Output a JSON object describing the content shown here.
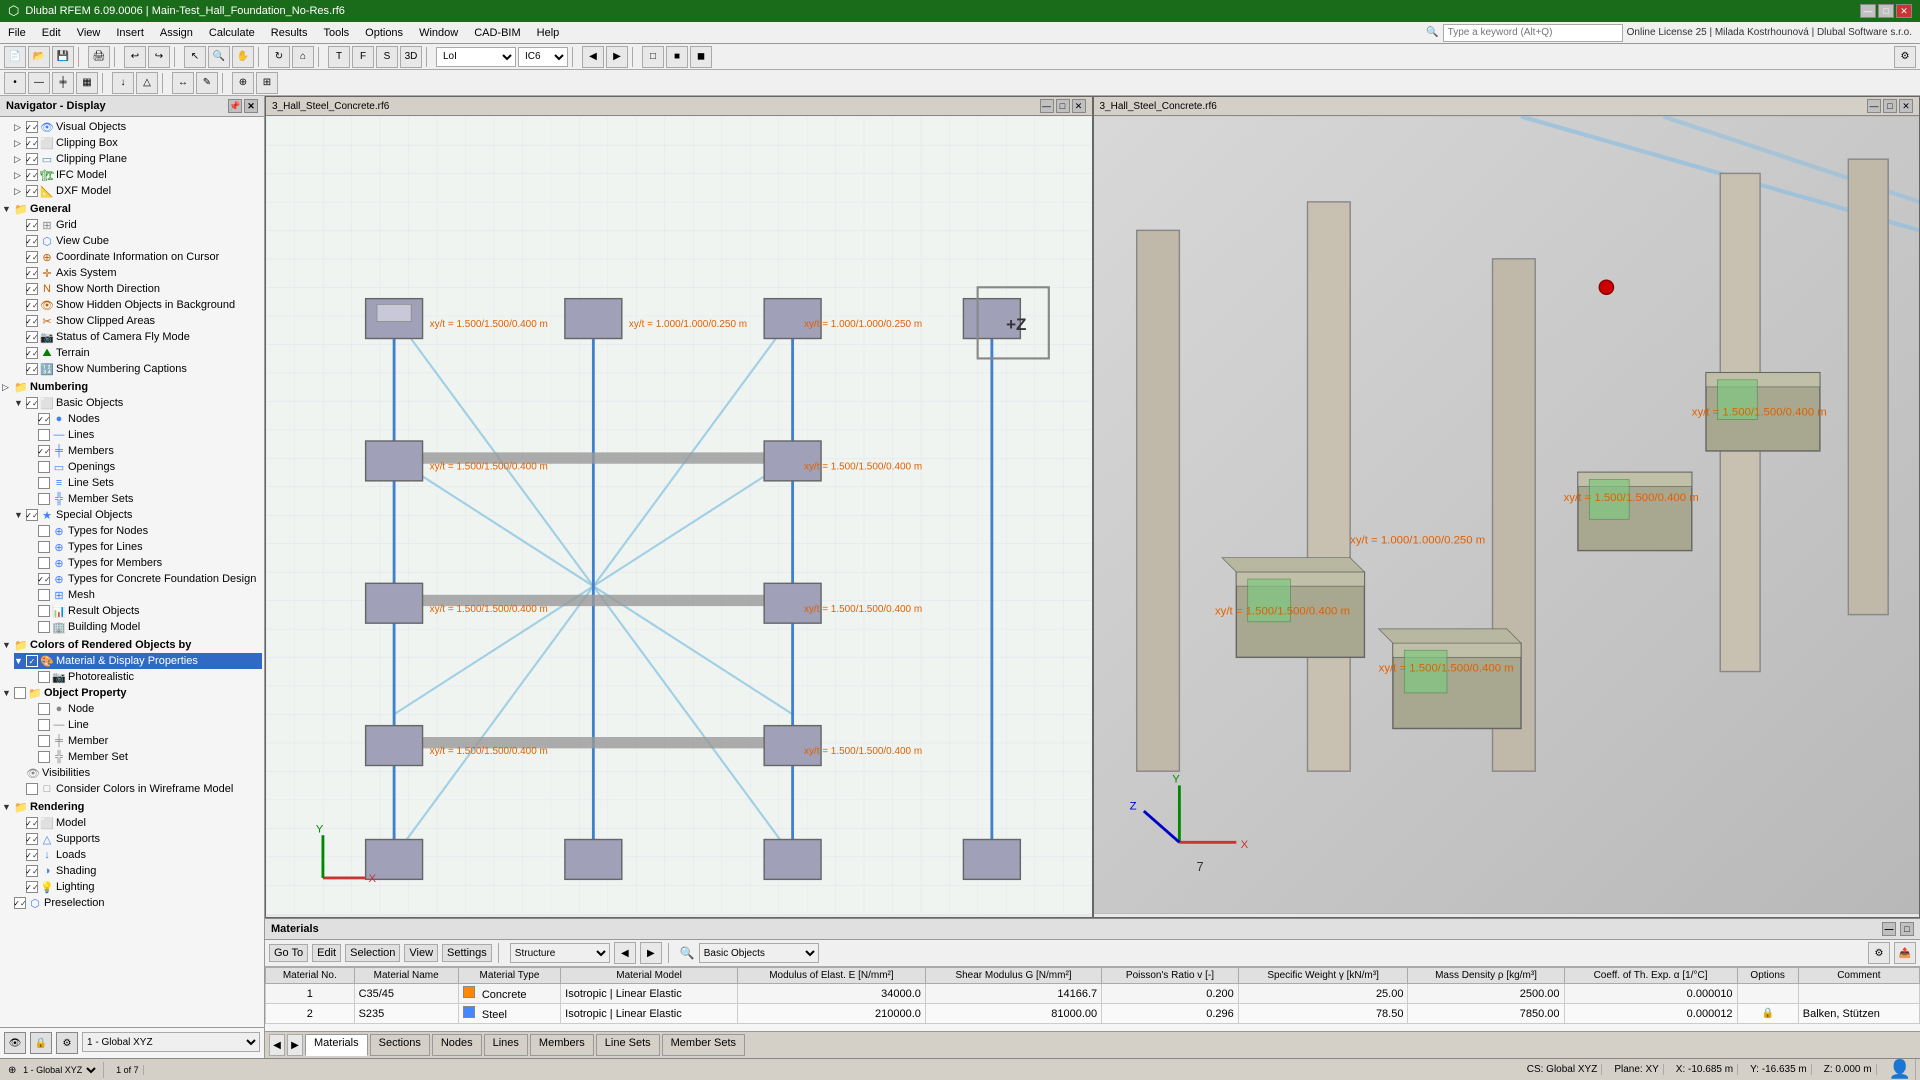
{
  "titleBar": {
    "title": "Dlubal RFEM 6.09.0006 | Main-Test_Hall_Foundation_No-Res.rf6",
    "minimize": "—",
    "maximize": "□",
    "close": "✕"
  },
  "menuBar": {
    "items": [
      "File",
      "Edit",
      "View",
      "Insert",
      "Assign",
      "Calculate",
      "Results",
      "Tools",
      "Options",
      "Window",
      "CAD-BIM",
      "Help"
    ]
  },
  "toolbars": {
    "searchPlaceholder": "Type a keyword (Alt+Q)",
    "license": "Online License 25 | Milada Kostrhounová | Dlubal Software s.r.o.",
    "lodLabel": "LoI",
    "icLabel": "IC6"
  },
  "navigator": {
    "title": "Navigator - Display",
    "sections": {
      "general": "General",
      "items": [
        {
          "label": "Visual Objects",
          "checked": true,
          "indent": 1
        },
        {
          "label": "Clipping Box",
          "checked": true,
          "indent": 1
        },
        {
          "label": "Clipping Plane",
          "checked": true,
          "indent": 1
        },
        {
          "label": "IFC Model",
          "checked": true,
          "indent": 1
        },
        {
          "label": "DXF Model",
          "checked": true,
          "indent": 1
        },
        {
          "label": "General",
          "isGroup": true,
          "indent": 0
        },
        {
          "label": "Grid",
          "checked": true,
          "indent": 1
        },
        {
          "label": "View Cube",
          "checked": true,
          "indent": 1
        },
        {
          "label": "Coordinate Information on Cursor",
          "checked": true,
          "indent": 1
        },
        {
          "label": "Axis System",
          "checked": true,
          "indent": 1
        },
        {
          "label": "Show North Direction",
          "checked": true,
          "indent": 1
        },
        {
          "label": "Show Hidden Objects in Background",
          "checked": true,
          "indent": 1
        },
        {
          "label": "Show Clipped Areas",
          "checked": true,
          "indent": 1
        },
        {
          "label": "Status of Camera Fly Mode",
          "checked": true,
          "indent": 1
        },
        {
          "label": "Terrain",
          "checked": true,
          "indent": 1
        },
        {
          "label": "Show Numbering Captions",
          "checked": true,
          "indent": 1
        },
        {
          "label": "Numbering",
          "isGroup": true,
          "indent": 0
        },
        {
          "label": "Basic Objects",
          "isGroup": true,
          "indent": 1
        },
        {
          "label": "Nodes",
          "checked": true,
          "indent": 2
        },
        {
          "label": "Lines",
          "checked": false,
          "indent": 2
        },
        {
          "label": "Members",
          "checked": true,
          "indent": 2
        },
        {
          "label": "Openings",
          "checked": false,
          "indent": 2
        },
        {
          "label": "Line Sets",
          "checked": false,
          "indent": 2
        },
        {
          "label": "Member Sets",
          "checked": false,
          "indent": 2
        },
        {
          "label": "Special Objects",
          "isGroup": true,
          "indent": 1
        },
        {
          "label": "Types for Nodes",
          "checked": false,
          "indent": 2
        },
        {
          "label": "Types for Lines",
          "checked": false,
          "indent": 2
        },
        {
          "label": "Types for Members",
          "checked": false,
          "indent": 2
        },
        {
          "label": "Types for Concrete Foundation Design",
          "checked": true,
          "indent": 2
        },
        {
          "label": "Mesh",
          "checked": false,
          "indent": 2
        },
        {
          "label": "Result Objects",
          "checked": false,
          "indent": 2
        },
        {
          "label": "Building Model",
          "checked": false,
          "indent": 2
        },
        {
          "label": "Colors of Rendered Objects by",
          "isGroup": true,
          "indent": 0
        },
        {
          "label": "Material & Display Properties",
          "checked": true,
          "indent": 1,
          "selected": true
        },
        {
          "label": "Photorealistic",
          "checked": false,
          "indent": 2
        },
        {
          "label": "Object Property",
          "isGroup": true,
          "indent": 0
        },
        {
          "label": "Node",
          "checked": false,
          "indent": 2
        },
        {
          "label": "Line",
          "checked": false,
          "indent": 2
        },
        {
          "label": "Member",
          "checked": false,
          "indent": 2
        },
        {
          "label": "Member Set",
          "checked": false,
          "indent": 2
        },
        {
          "label": "Visibilities",
          "indent": 1
        },
        {
          "label": "Consider Colors in Wireframe Model",
          "checked": false,
          "indent": 1
        },
        {
          "label": "Rendering",
          "isGroup": true,
          "indent": 0
        },
        {
          "label": "Model",
          "checked": true,
          "indent": 1
        },
        {
          "label": "Supports",
          "checked": true,
          "indent": 1
        },
        {
          "label": "Loads",
          "checked": true,
          "indent": 1
        },
        {
          "label": "Shading",
          "checked": true,
          "indent": 1
        },
        {
          "label": "Lighting",
          "checked": true,
          "indent": 1
        },
        {
          "label": "Preselection",
          "checked": true,
          "indent": 0
        }
      ]
    }
  },
  "navBottom": {
    "items": [
      "1 - Global XYZ"
    ]
  },
  "viewport1": {
    "title": "3_Hall_Steel_Concrete.rf6",
    "labels": {
      "zPlus": "+Z"
    }
  },
  "viewport2": {
    "title": "3_Hall_Steel_Concrete.rf6",
    "coordLabel1": "xy/t = 1.000/1.000/0.250 m",
    "coordLabel2": "xy/t = 1.500/1.500/0.400 m",
    "coordLabel3": "xy/t = 1.500/1.500/0.400 m",
    "coordLabel4": "xy/t = 1.500/1.500/0.400 m"
  },
  "bottomPanel": {
    "title": "Materials",
    "toolbar": {
      "goTo": "Go To",
      "edit": "Edit",
      "selection": "Selection",
      "view": "View",
      "settings": "Settings"
    },
    "filterLabel": "Structure",
    "typeLabel": "Basic Objects",
    "tabs": [
      "Materials",
      "Sections",
      "Nodes",
      "Lines",
      "Members",
      "Line Sets",
      "Member Sets"
    ],
    "activeTab": "Materials",
    "columns": [
      "Material No.",
      "Material Name",
      "Material Type",
      "Material Model",
      "Modulus of Elast. E [N/mm²]",
      "Shear Modulus G [N/mm²]",
      "Poisson's Ratio v [-]",
      "Specific Weight γ [kN/m³]",
      "Mass Density ρ [kg/m³]",
      "Coeff. of Th. Exp. α [1/°C]",
      "Options",
      "Comment"
    ],
    "rows": [
      {
        "no": "1",
        "name": "C35/45",
        "type": "Concrete",
        "typeColor": "#ff8800",
        "model": "Isotropic | Linear Elastic",
        "E": "34000.0",
        "G": "14166.7",
        "v": "0.200",
        "gamma": "25.00",
        "rho": "2500.00",
        "alpha": "0.000010",
        "comment": ""
      },
      {
        "no": "2",
        "name": "S235",
        "type": "Steel",
        "typeColor": "#4488ff",
        "model": "Isotropic | Linear Elastic",
        "E": "210000.0",
        "G": "81000.00",
        "v": "0.296",
        "gamma": "78.50",
        "rho": "7850.00",
        "alpha": "0.000012",
        "comment": "Balken, Stützen"
      }
    ],
    "pageInfo": "1 of 7"
  },
  "statusBar": {
    "coordSystem": "1 - Global XYZ",
    "cs": "CS: Global XYZ",
    "plane": "Plane: XY",
    "x": "X: -10.685 m",
    "y": "Y: -16.635 m",
    "z": "Z: 0.000 m"
  },
  "sections": {
    "tabLabel": "Sections"
  }
}
